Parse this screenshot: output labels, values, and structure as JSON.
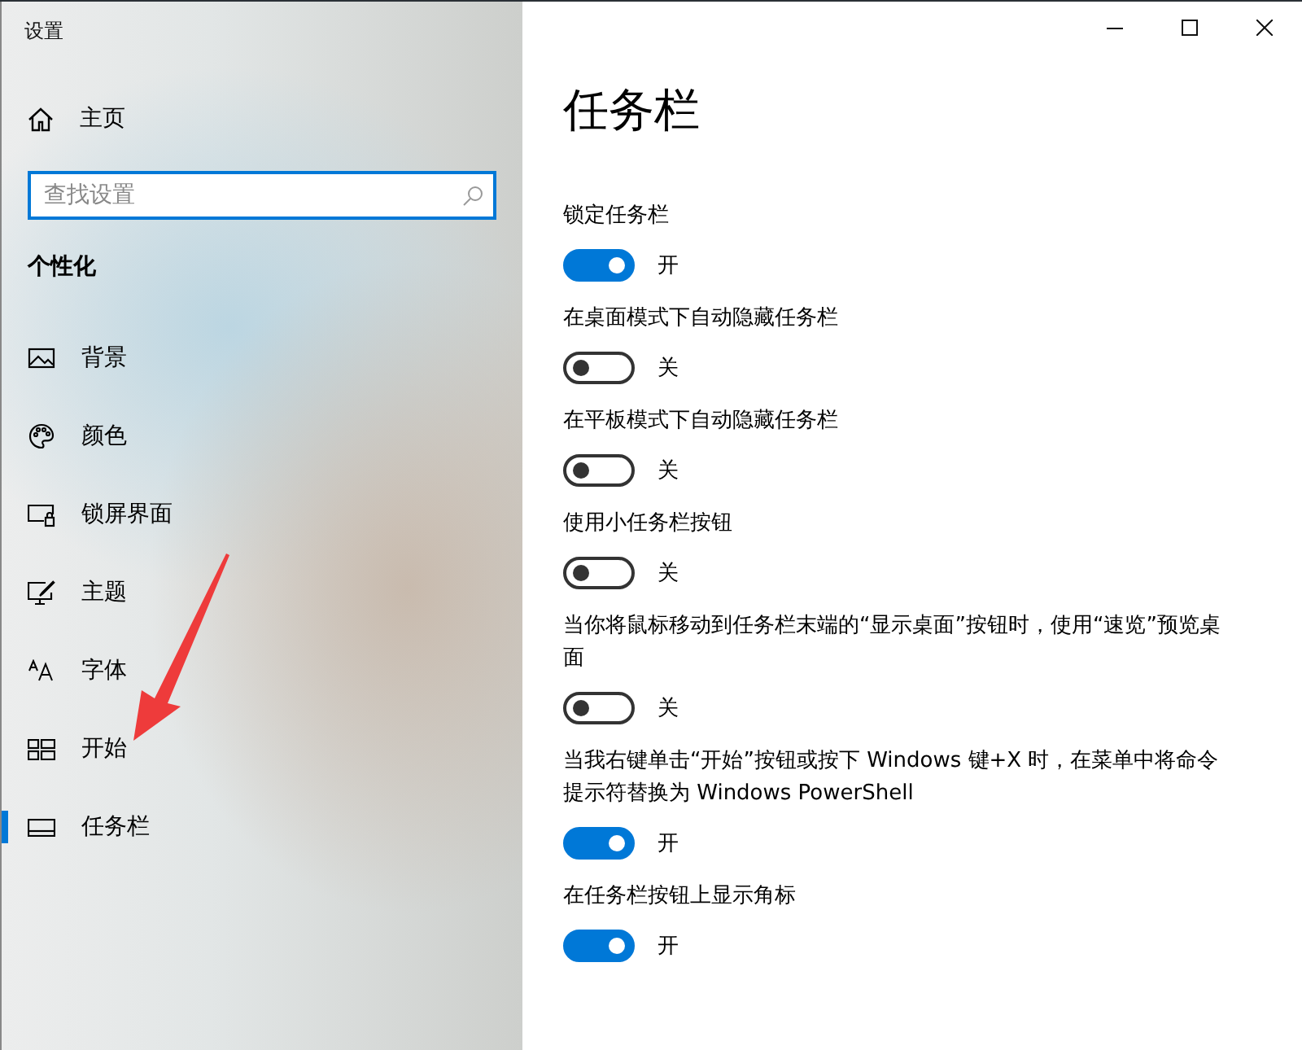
{
  "window": {
    "title": "设置",
    "controls": [
      {
        "kind": "minimize"
      },
      {
        "kind": "maximize"
      },
      {
        "kind": "close"
      }
    ]
  },
  "sidebar": {
    "home": "主页",
    "search": {
      "placeholder": "查找设置"
    },
    "section": "个性化",
    "items": [
      {
        "label": "背景",
        "kind": "picture",
        "selected": false
      },
      {
        "label": "颜色",
        "kind": "palette",
        "selected": false
      },
      {
        "label": "锁屏界面",
        "kind": "lockscreen",
        "selected": false
      },
      {
        "label": "主题",
        "kind": "theme",
        "selected": false
      },
      {
        "label": "字体",
        "kind": "font",
        "selected": false
      },
      {
        "label": "开始",
        "kind": "start",
        "selected": false
      },
      {
        "label": "任务栏",
        "kind": "taskbar",
        "selected": true
      }
    ]
  },
  "page": {
    "title": "任务栏",
    "settings": [
      {
        "label": "锁定任务栏",
        "on": true,
        "state_text": "开"
      },
      {
        "label": "在桌面模式下自动隐藏任务栏",
        "on": false,
        "state_text": "关"
      },
      {
        "label": "在平板模式下自动隐藏任务栏",
        "on": false,
        "state_text": "关"
      },
      {
        "label": "使用小任务栏按钮",
        "on": false,
        "state_text": "关"
      },
      {
        "label": "当你将鼠标移动到任务栏末端的“显示桌面”按钮时，使用“速览”预览桌面",
        "on": false,
        "state_text": "关"
      },
      {
        "label": "当我右键单击“开始”按钮或按下 Windows 键+X 时，在菜单中将命令提示符替换为 Windows PowerShell",
        "on": true,
        "state_text": "开"
      },
      {
        "label": "在任务栏按钮上显示角标",
        "on": true,
        "state_text": "开"
      }
    ]
  },
  "annotations": [
    {
      "kind": "arrow"
    }
  ]
}
